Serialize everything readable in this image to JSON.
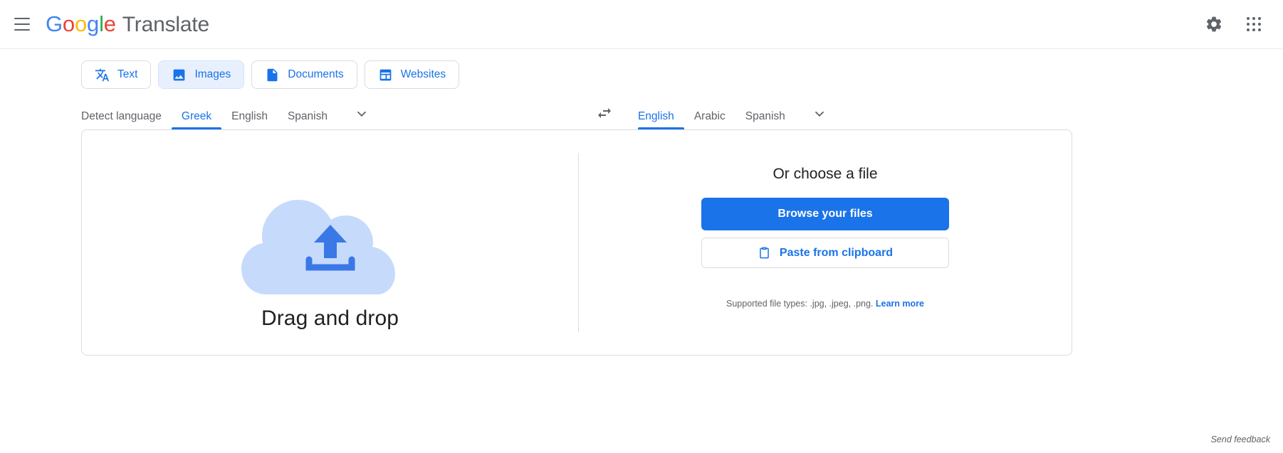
{
  "header": {
    "menu_label": "Main menu",
    "brand": {
      "g": "G",
      "o1": "o",
      "o2": "o",
      "g2": "g",
      "l": "l",
      "e": "e",
      "word": "Translate"
    },
    "settings_label": "Settings",
    "apps_label": "Google apps"
  },
  "tabs": [
    {
      "label": "Text",
      "icon": "translate-icon",
      "active": false
    },
    {
      "label": "Images",
      "icon": "image-icon",
      "active": true
    },
    {
      "label": "Documents",
      "icon": "document-icon",
      "active": false
    },
    {
      "label": "Websites",
      "icon": "website-icon",
      "active": false
    }
  ],
  "source_languages": [
    {
      "label": "Detect language",
      "selected": false
    },
    {
      "label": "Greek",
      "selected": true
    },
    {
      "label": "English",
      "selected": false
    },
    {
      "label": "Spanish",
      "selected": false
    }
  ],
  "target_languages": [
    {
      "label": "English",
      "selected": true
    },
    {
      "label": "Arabic",
      "selected": false
    },
    {
      "label": "Spanish",
      "selected": false
    }
  ],
  "swap_icon": "swap-horizontal-icon",
  "more_languages_icon": "chevron-down-icon",
  "upload": {
    "drag_and_drop": "Drag and drop",
    "cloud_icon": "cloud-upload-icon",
    "choose_title": "Or choose a file",
    "browse_button": "Browse your files",
    "paste_button": "Paste from clipboard",
    "paste_icon": "clipboard-icon",
    "file_types_text": "Supported file types: .jpg, .jpeg, .png.",
    "learn_more": "Learn more"
  },
  "footer": {
    "send_feedback": "Send feedback"
  },
  "colors": {
    "accent": "#1a73e8",
    "tab_active_bg": "#e8f0fe",
    "cloud": "#c6dafc",
    "border": "#dadce0",
    "text_secondary": "#5f6368"
  }
}
